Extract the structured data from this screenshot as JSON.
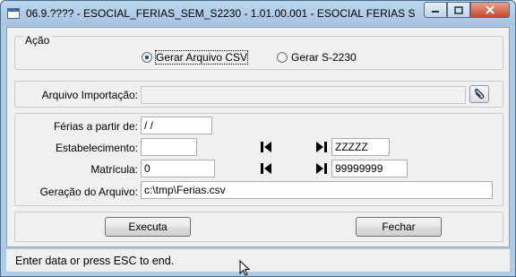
{
  "window": {
    "title": "06.9.???? - ESOCIAL_FERIAS_SEM_S2230 - 1.01.00.001 - ESOCIAL FERIAS SEM S2...",
    "minimize_icon": "minimize-icon",
    "maximize_icon": "maximize-icon",
    "close_icon": "close-icon"
  },
  "acao": {
    "legend": "Ação",
    "options": [
      {
        "label": "Gerar Arquivo CSV",
        "checked": true
      },
      {
        "label": "Gerar S-2230",
        "checked": false
      }
    ]
  },
  "import": {
    "label": "Arquivo Importação:",
    "value": "",
    "browse_icon": "paperclip-icon"
  },
  "fields": {
    "ferias_label": "Férias a partir de:",
    "ferias_value": " / /",
    "estabelecimento_label": "Estabelecimento:",
    "estabelecimento_from": "",
    "estabelecimento_to": "ZZZZZ",
    "matricula_label": "Matrícula:",
    "matricula_from": "0",
    "matricula_to": "99999999",
    "geracao_label": "Geração do Arquivo:",
    "geracao_value": "c:\\tmp\\Ferias.csv",
    "first_icon": "first-record-icon",
    "last_icon": "last-record-icon"
  },
  "buttons": {
    "executa": "Executa",
    "fechar": "Fechar"
  },
  "status": {
    "text": "Enter data or press ESC to end."
  }
}
